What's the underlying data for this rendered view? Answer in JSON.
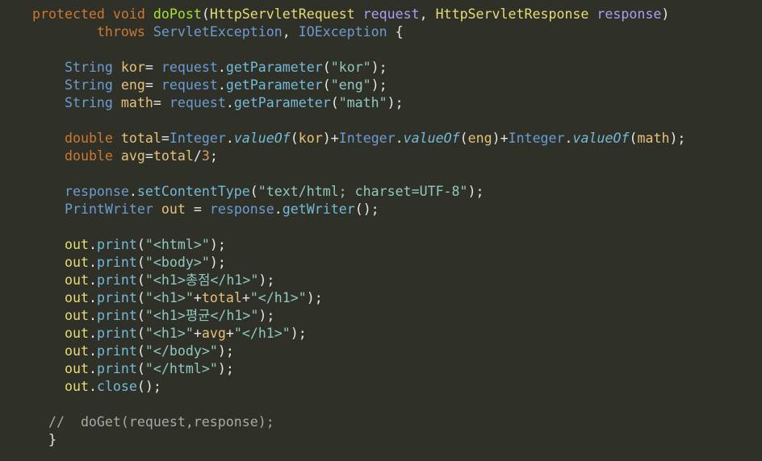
{
  "editor": {
    "lines": [
      {
        "tokens": [
          {
            "c": "k-storage",
            "t": "protected"
          },
          {
            "c": "plain",
            "t": " "
          },
          {
            "c": "k-storage",
            "t": "void"
          },
          {
            "c": "plain",
            "t": " "
          },
          {
            "c": "fn-def",
            "t": "doPost"
          },
          {
            "c": "punc",
            "t": "("
          },
          {
            "c": "type",
            "t": "HttpServletRequest"
          },
          {
            "c": "plain",
            "t": " "
          },
          {
            "c": "param",
            "t": "request"
          },
          {
            "c": "punc",
            "t": ", "
          },
          {
            "c": "type",
            "t": "HttpServletResponse"
          },
          {
            "c": "plain",
            "t": " "
          },
          {
            "c": "param",
            "t": "response"
          },
          {
            "c": "punc",
            "t": ")"
          }
        ]
      },
      {
        "tokens": [
          {
            "c": "plain",
            "t": "        "
          },
          {
            "c": "k-throws",
            "t": "throws"
          },
          {
            "c": "plain",
            "t": " "
          },
          {
            "c": "exc",
            "t": "ServletException"
          },
          {
            "c": "punc",
            "t": ", "
          },
          {
            "c": "exc",
            "t": "IOException"
          },
          {
            "c": "plain",
            "t": " "
          },
          {
            "c": "punc",
            "t": "{"
          }
        ]
      },
      {
        "tokens": []
      },
      {
        "tokens": [
          {
            "c": "plain",
            "t": "    "
          },
          {
            "c": "local-type",
            "t": "String"
          },
          {
            "c": "plain",
            "t": " "
          },
          {
            "c": "var",
            "t": "kor"
          },
          {
            "c": "op",
            "t": "= "
          },
          {
            "c": "obj",
            "t": "request"
          },
          {
            "c": "punc",
            "t": "."
          },
          {
            "c": "method",
            "t": "getParameter"
          },
          {
            "c": "punc",
            "t": "("
          },
          {
            "c": "str",
            "t": "\"kor\""
          },
          {
            "c": "punc",
            "t": ");"
          }
        ]
      },
      {
        "tokens": [
          {
            "c": "plain",
            "t": "    "
          },
          {
            "c": "local-type",
            "t": "String"
          },
          {
            "c": "plain",
            "t": " "
          },
          {
            "c": "var",
            "t": "eng"
          },
          {
            "c": "op",
            "t": "= "
          },
          {
            "c": "obj",
            "t": "request"
          },
          {
            "c": "punc",
            "t": "."
          },
          {
            "c": "method",
            "t": "getParameter"
          },
          {
            "c": "punc",
            "t": "("
          },
          {
            "c": "str",
            "t": "\"eng\""
          },
          {
            "c": "punc",
            "t": ");"
          }
        ]
      },
      {
        "tokens": [
          {
            "c": "plain",
            "t": "    "
          },
          {
            "c": "local-type",
            "t": "String"
          },
          {
            "c": "plain",
            "t": " "
          },
          {
            "c": "var",
            "t": "math"
          },
          {
            "c": "op",
            "t": "= "
          },
          {
            "c": "obj",
            "t": "request"
          },
          {
            "c": "punc",
            "t": "."
          },
          {
            "c": "method",
            "t": "getParameter"
          },
          {
            "c": "punc",
            "t": "("
          },
          {
            "c": "str",
            "t": "\"math\""
          },
          {
            "c": "punc",
            "t": ");"
          }
        ]
      },
      {
        "tokens": []
      },
      {
        "tokens": [
          {
            "c": "plain",
            "t": "    "
          },
          {
            "c": "k-storage",
            "t": "double"
          },
          {
            "c": "plain",
            "t": " "
          },
          {
            "c": "var",
            "t": "total"
          },
          {
            "c": "op",
            "t": "="
          },
          {
            "c": "obj",
            "t": "Integer"
          },
          {
            "c": "punc",
            "t": "."
          },
          {
            "c": "static-method",
            "t": "valueOf"
          },
          {
            "c": "punc",
            "t": "("
          },
          {
            "c": "var",
            "t": "kor"
          },
          {
            "c": "punc",
            "t": ")"
          },
          {
            "c": "op",
            "t": "+"
          },
          {
            "c": "obj",
            "t": "Integer"
          },
          {
            "c": "punc",
            "t": "."
          },
          {
            "c": "static-method",
            "t": "valueOf"
          },
          {
            "c": "punc",
            "t": "("
          },
          {
            "c": "var",
            "t": "eng"
          },
          {
            "c": "punc",
            "t": ")"
          },
          {
            "c": "op",
            "t": "+"
          },
          {
            "c": "obj",
            "t": "Integer"
          },
          {
            "c": "punc",
            "t": "."
          },
          {
            "c": "static-method",
            "t": "valueOf"
          },
          {
            "c": "punc",
            "t": "("
          },
          {
            "c": "var",
            "t": "math"
          },
          {
            "c": "punc",
            "t": ");"
          }
        ]
      },
      {
        "tokens": [
          {
            "c": "plain",
            "t": "    "
          },
          {
            "c": "k-storage",
            "t": "double"
          },
          {
            "c": "plain",
            "t": " "
          },
          {
            "c": "var",
            "t": "avg"
          },
          {
            "c": "op",
            "t": "="
          },
          {
            "c": "var",
            "t": "total"
          },
          {
            "c": "op",
            "t": "/"
          },
          {
            "c": "num",
            "t": "3"
          },
          {
            "c": "punc",
            "t": ";"
          }
        ]
      },
      {
        "tokens": []
      },
      {
        "tokens": [
          {
            "c": "plain",
            "t": "    "
          },
          {
            "c": "obj",
            "t": "response"
          },
          {
            "c": "punc",
            "t": "."
          },
          {
            "c": "method",
            "t": "setContentType"
          },
          {
            "c": "punc",
            "t": "("
          },
          {
            "c": "str",
            "t": "\"text/html; charset=UTF-8\""
          },
          {
            "c": "punc",
            "t": ");"
          }
        ]
      },
      {
        "tokens": [
          {
            "c": "plain",
            "t": "    "
          },
          {
            "c": "local-type",
            "t": "PrintWriter"
          },
          {
            "c": "plain",
            "t": " "
          },
          {
            "c": "var",
            "t": "out"
          },
          {
            "c": "op",
            "t": " = "
          },
          {
            "c": "obj",
            "t": "response"
          },
          {
            "c": "punc",
            "t": "."
          },
          {
            "c": "method",
            "t": "getWriter"
          },
          {
            "c": "punc",
            "t": "();"
          }
        ]
      },
      {
        "tokens": []
      },
      {
        "tokens": [
          {
            "c": "plain",
            "t": "    "
          },
          {
            "c": "out",
            "t": "out"
          },
          {
            "c": "punc",
            "t": "."
          },
          {
            "c": "method",
            "t": "print"
          },
          {
            "c": "punc",
            "t": "("
          },
          {
            "c": "str",
            "t": "\"<html>\""
          },
          {
            "c": "punc",
            "t": ");"
          }
        ]
      },
      {
        "tokens": [
          {
            "c": "plain",
            "t": "    "
          },
          {
            "c": "out",
            "t": "out"
          },
          {
            "c": "punc",
            "t": "."
          },
          {
            "c": "method",
            "t": "print"
          },
          {
            "c": "punc",
            "t": "("
          },
          {
            "c": "str",
            "t": "\"<body>\""
          },
          {
            "c": "punc",
            "t": ");"
          }
        ]
      },
      {
        "tokens": [
          {
            "c": "plain",
            "t": "    "
          },
          {
            "c": "out",
            "t": "out"
          },
          {
            "c": "punc",
            "t": "."
          },
          {
            "c": "method",
            "t": "print"
          },
          {
            "c": "punc",
            "t": "("
          },
          {
            "c": "str",
            "t": "\"<h1>총점</h1>\""
          },
          {
            "c": "punc",
            "t": ");"
          }
        ]
      },
      {
        "tokens": [
          {
            "c": "plain",
            "t": "    "
          },
          {
            "c": "out",
            "t": "out"
          },
          {
            "c": "punc",
            "t": "."
          },
          {
            "c": "method",
            "t": "print"
          },
          {
            "c": "punc",
            "t": "("
          },
          {
            "c": "str",
            "t": "\"<h1>\""
          },
          {
            "c": "op",
            "t": "+"
          },
          {
            "c": "var",
            "t": "total"
          },
          {
            "c": "op",
            "t": "+"
          },
          {
            "c": "str",
            "t": "\"</h1>\""
          },
          {
            "c": "punc",
            "t": ");"
          }
        ]
      },
      {
        "tokens": [
          {
            "c": "plain",
            "t": "    "
          },
          {
            "c": "out",
            "t": "out"
          },
          {
            "c": "punc",
            "t": "."
          },
          {
            "c": "method",
            "t": "print"
          },
          {
            "c": "punc",
            "t": "("
          },
          {
            "c": "str",
            "t": "\"<h1>평균</h1>\""
          },
          {
            "c": "punc",
            "t": ");"
          }
        ]
      },
      {
        "tokens": [
          {
            "c": "plain",
            "t": "    "
          },
          {
            "c": "out",
            "t": "out"
          },
          {
            "c": "punc",
            "t": "."
          },
          {
            "c": "method",
            "t": "print"
          },
          {
            "c": "punc",
            "t": "("
          },
          {
            "c": "str",
            "t": "\"<h1>\""
          },
          {
            "c": "op",
            "t": "+"
          },
          {
            "c": "var",
            "t": "avg"
          },
          {
            "c": "op",
            "t": "+"
          },
          {
            "c": "str",
            "t": "\"</h1>\""
          },
          {
            "c": "punc",
            "t": ");"
          }
        ]
      },
      {
        "tokens": [
          {
            "c": "plain",
            "t": "    "
          },
          {
            "c": "out",
            "t": "out"
          },
          {
            "c": "punc",
            "t": "."
          },
          {
            "c": "method",
            "t": "print"
          },
          {
            "c": "punc",
            "t": "("
          },
          {
            "c": "str",
            "t": "\"</body>\""
          },
          {
            "c": "punc",
            "t": ");"
          }
        ]
      },
      {
        "tokens": [
          {
            "c": "plain",
            "t": "    "
          },
          {
            "c": "out",
            "t": "out"
          },
          {
            "c": "punc",
            "t": "."
          },
          {
            "c": "method",
            "t": "print"
          },
          {
            "c": "punc",
            "t": "("
          },
          {
            "c": "str",
            "t": "\"</html>\""
          },
          {
            "c": "punc",
            "t": ");"
          }
        ]
      },
      {
        "tokens": [
          {
            "c": "plain",
            "t": "    "
          },
          {
            "c": "out",
            "t": "out"
          },
          {
            "c": "punc",
            "t": "."
          },
          {
            "c": "method",
            "t": "close"
          },
          {
            "c": "punc",
            "t": "();"
          }
        ]
      },
      {
        "tokens": []
      },
      {
        "tokens": [
          {
            "c": "plain",
            "t": "  "
          },
          {
            "c": "comment",
            "t": "//  doGet(request,response);"
          }
        ]
      },
      {
        "tokens": [
          {
            "c": "plain",
            "t": "  "
          },
          {
            "c": "punc",
            "t": "}"
          }
        ]
      }
    ],
    "colors": {
      "background": "#2f3129",
      "keyword": "#cc7832",
      "function_def": "#a6e22e",
      "type": "#e6db74",
      "parameter": "#ab9df2",
      "class_ref": "#6c9bd2",
      "method": "#74b9d6",
      "string": "#90c8c0",
      "number": "#d19a66",
      "comment": "#a8a8a8"
    }
  }
}
